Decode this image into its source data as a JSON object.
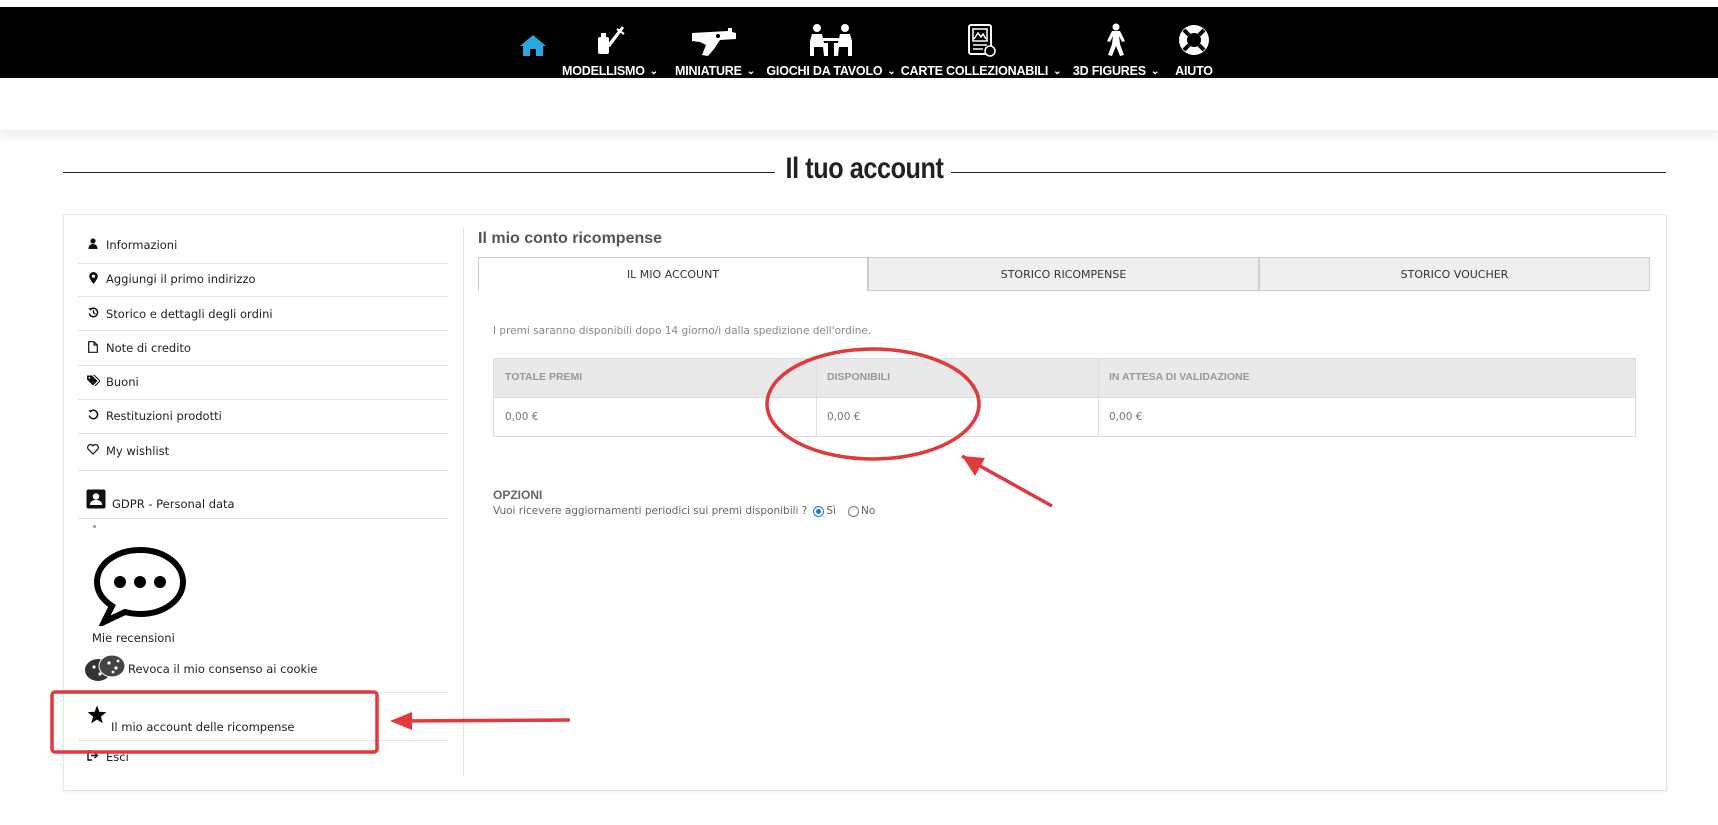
{
  "nav": {
    "home_icon": "home-icon",
    "items": [
      {
        "label": "MODELLISMO",
        "icon": "paintbrush-icon"
      },
      {
        "label": "MINIATURE",
        "icon": "blaster-icon"
      },
      {
        "label": "GIOCHI DA TAVOLO",
        "icon": "board-game-players-icon"
      },
      {
        "label": "CARTE COLLEZIONABILI",
        "icon": "card-icon"
      },
      {
        "label": "3D FIGURES",
        "icon": "figure-icon"
      },
      {
        "label": "AIUTO",
        "icon": "lifebuoy-icon"
      }
    ],
    "chevron": "⌄"
  },
  "page": {
    "title": "Il tuo account"
  },
  "sidebar": {
    "items": [
      {
        "label": "Informazioni",
        "icon": "user-icon"
      },
      {
        "label": "Aggiungi il primo indirizzo",
        "icon": "map-pin-icon"
      },
      {
        "label": "Storico e dettagli degli ordini",
        "icon": "history-icon"
      },
      {
        "label": "Note di credito",
        "icon": "document-icon"
      },
      {
        "label": "Buoni",
        "icon": "tags-icon"
      },
      {
        "label": "Restituzioni prodotti",
        "icon": "undo-icon"
      },
      {
        "label": "My wishlist",
        "icon": "heart-icon"
      },
      {
        "label": "GDPR - Personal data",
        "icon": "id-card-icon"
      },
      {
        "label": "Mie recensioni",
        "icon": "speech-bubble-icon"
      },
      {
        "label": "Revoca il mio consenso ai cookie",
        "icon": "cookie-icon"
      },
      {
        "label": "Il mio account delle ricompense",
        "icon": "star-icon"
      },
      {
        "label": "Esci",
        "icon": "sign-out-icon"
      }
    ]
  },
  "content": {
    "title": "Il mio conto ricompense",
    "tabs": [
      "IL MIO ACCOUNT",
      "STORICO RICOMPENSE",
      "STORICO VOUCHER"
    ],
    "note": "I premi saranno disponibili dopo 14 giorno/i dalla spedizione dell'ordine.",
    "table": {
      "headers": [
        "TOTALE PREMI",
        "DISPONIBILI",
        "IN ATTESA DI VALIDAZIONE"
      ],
      "row": [
        "0,00 €",
        "0,00 €",
        "0,00 €"
      ]
    },
    "options": {
      "title": "OPZIONI",
      "question": "Vuoi ricevere aggiornamenti periodici sui premi disponibili ?",
      "yes": "Sì",
      "no": "No",
      "selected": "Sì"
    }
  },
  "annotations": {
    "color": "#e0393e"
  }
}
